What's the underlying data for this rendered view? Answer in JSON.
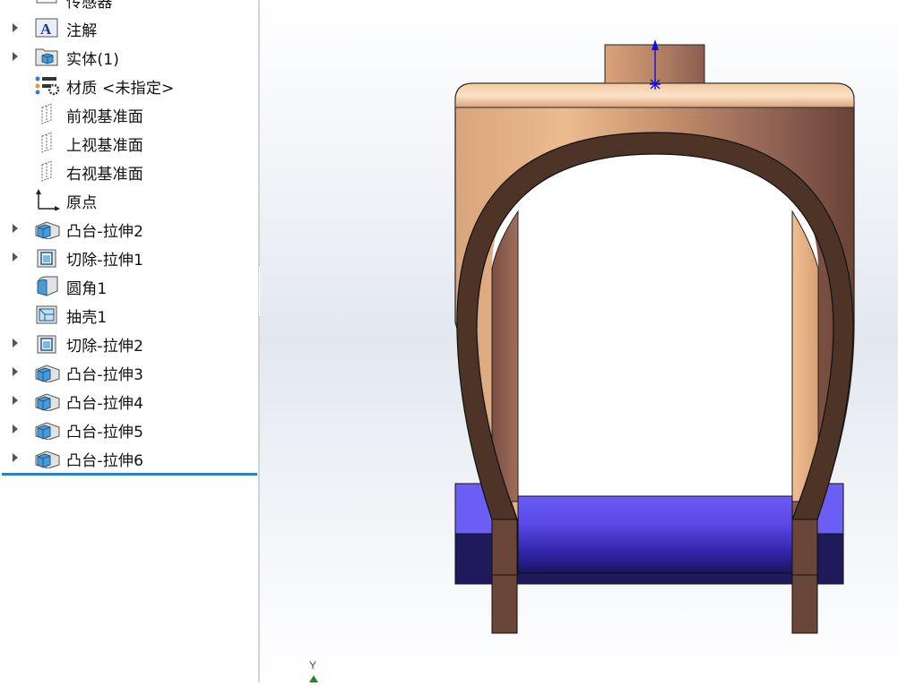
{
  "feature_tree": {
    "items": [
      {
        "label": "传感器",
        "icon": "sensor-icon",
        "expandable": false
      },
      {
        "label": "注解",
        "icon": "annotation-icon",
        "expandable": true
      },
      {
        "label": "实体(1)",
        "icon": "solid-bodies-folder-icon",
        "expandable": true
      },
      {
        "label": "材质 <未指定>",
        "icon": "material-icon",
        "expandable": false
      },
      {
        "label": "前视基准面",
        "icon": "plane-icon",
        "expandable": false
      },
      {
        "label": "上视基准面",
        "icon": "plane-icon",
        "expandable": false
      },
      {
        "label": "右视基准面",
        "icon": "plane-icon",
        "expandable": false
      },
      {
        "label": "原点",
        "icon": "origin-icon",
        "expandable": false
      },
      {
        "label": "凸台-拉伸2",
        "icon": "boss-extrude-icon",
        "expandable": true
      },
      {
        "label": "切除-拉伸1",
        "icon": "cut-extrude-icon",
        "expandable": true
      },
      {
        "label": "圆角1",
        "icon": "fillet-icon",
        "expandable": false
      },
      {
        "label": "抽壳1",
        "icon": "shell-icon",
        "expandable": false
      },
      {
        "label": "切除-拉伸2",
        "icon": "cut-extrude-icon",
        "expandable": true
      },
      {
        "label": "凸台-拉伸3",
        "icon": "boss-extrude-icon",
        "expandable": true
      },
      {
        "label": "凸台-拉伸4",
        "icon": "boss-extrude-icon",
        "expandable": true
      },
      {
        "label": "凸台-拉伸5",
        "icon": "boss-extrude-icon",
        "expandable": true
      },
      {
        "label": "凸台-拉伸6",
        "icon": "boss-extrude-icon",
        "expandable": true
      }
    ]
  },
  "viewport": {
    "triad_axis_label": "Y",
    "colors": {
      "copper_light": "#e8b88c",
      "copper_dark": "#6a4336",
      "frame_brown": "#4c3427",
      "pin_blue": "#5b4cf0",
      "pin_blue_dark": "#1e1a5c",
      "sketch_blue": "#1010dd",
      "selection_bar": "#2a7fd0"
    }
  }
}
